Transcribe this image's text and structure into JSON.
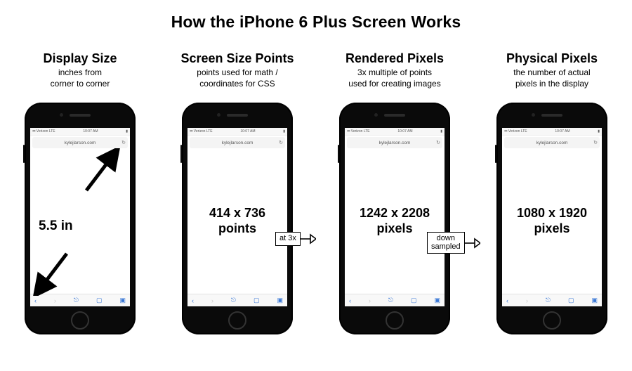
{
  "title": "How the iPhone 6 Plus Screen Works",
  "statusbar": {
    "signal": "•••••",
    "carrier": "Verizon  LTE",
    "time": "10:07 AM"
  },
  "browser": {
    "url": "kylejlarson.com"
  },
  "columns": [
    {
      "heading": "Display Size",
      "sub": "inches from\ncorner to corner",
      "main": "5.5 in"
    },
    {
      "heading": "Screen Size Points",
      "sub": "points used for math /\ncoordinates for CSS",
      "main": "414 x 736\npoints"
    },
    {
      "heading": "Rendered Pixels",
      "sub": "3x multiple of points\nused for creating images",
      "main": "1242 x 2208\npixels"
    },
    {
      "heading": "Physical Pixels",
      "sub": "the number of actual\npixels in the display",
      "main": "1080 x 1920\npixels"
    }
  ],
  "connectors": [
    {
      "label": "at 3x"
    },
    {
      "label": "down\nsampled"
    }
  ]
}
